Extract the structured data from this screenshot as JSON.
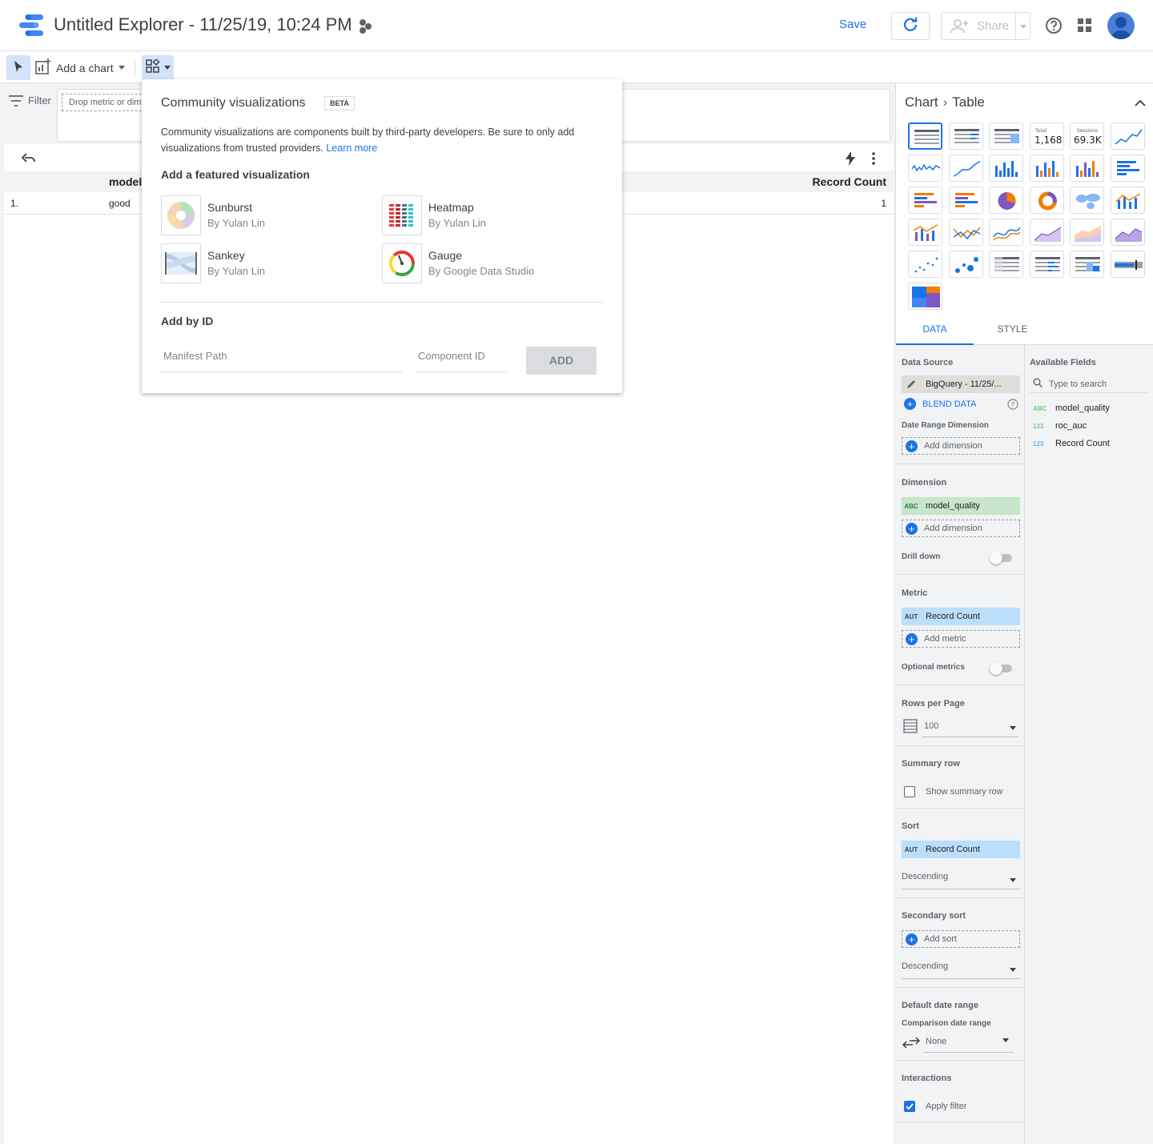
{
  "header": {
    "title": "Untitled Explorer - 11/25/19, 10:24 PM",
    "save_label": "Save",
    "share_label": "Share"
  },
  "toolbar": {
    "add_chart_label": "Add a chart"
  },
  "filter": {
    "label": "Filter",
    "drop_placeholder": "Drop metric or dim"
  },
  "table": {
    "columns": [
      "model_",
      "Record Count"
    ],
    "rows": [
      {
        "index": "1.",
        "model_quality": "good",
        "record_count": "1"
      }
    ]
  },
  "community_popup": {
    "title": "Community visualizations",
    "badge": "BETA",
    "description": "Community visualizations are components built by third-party developers. Be sure to only add visualizations from trusted providers.",
    "learn_more": "Learn more",
    "featured_heading": "Add a featured visualization",
    "featured": [
      {
        "name": "Sunburst",
        "by": "By Yulan Lin"
      },
      {
        "name": "Heatmap",
        "by": "By Yulan Lin"
      },
      {
        "name": "Sankey",
        "by": "By Yulan Lin"
      },
      {
        "name": "Gauge",
        "by": "By Google Data Studio"
      }
    ],
    "add_by_id_heading": "Add by ID",
    "manifest_placeholder": "Manifest Path",
    "component_placeholder": "Component ID",
    "add_button": "ADD"
  },
  "right_panel": {
    "breadcrumb_root": "Chart",
    "breadcrumb_current": "Table",
    "scorecard_1": {
      "label": "Total",
      "value": "1,168"
    },
    "scorecard_2": {
      "label": "Sessions",
      "value": "69.3K"
    },
    "tabs": [
      "DATA",
      "STYLE"
    ],
    "data": {
      "data_source_label": "Data Source",
      "data_source_value": "BigQuery - 11/25/...",
      "blend_label": "BLEND DATA",
      "date_range_dim_label": "Date Range Dimension",
      "add_dimension": "Add dimension",
      "dimension_label": "Dimension",
      "dimension_value": "model_quality",
      "dimension_type": "ABC",
      "drill_down": "Drill down",
      "metric_label": "Metric",
      "metric_value": "Record Count",
      "metric_type": "AUT",
      "add_metric": "Add metric",
      "optional_metrics": "Optional metrics",
      "rows_per_page_label": "Rows per Page",
      "rows_per_page_value": "100",
      "summary_row_label": "Summary row",
      "show_summary_row": "Show summary row",
      "sort_label": "Sort",
      "sort_value": "Record Count",
      "sort_order": "Descending",
      "secondary_sort_label": "Secondary sort",
      "add_sort": "Add sort",
      "secondary_sort_order": "Descending",
      "default_date_range": "Default date range",
      "comparison_date_range": "Comparison date range",
      "comparison_value": "None",
      "interactions_label": "Interactions",
      "apply_filter": "Apply filter"
    },
    "available_fields": {
      "heading": "Available Fields",
      "search_placeholder": "Type to search",
      "fields": [
        {
          "type": "ABC",
          "name": "model_quality"
        },
        {
          "type": "123",
          "name": "roc_auc"
        },
        {
          "type": "123",
          "name": "Record Count"
        }
      ]
    }
  },
  "colors": {
    "accent": "#1a73e8",
    "dimension_chip": "#c8e6c9",
    "metric_chip": "#bbdefb"
  }
}
